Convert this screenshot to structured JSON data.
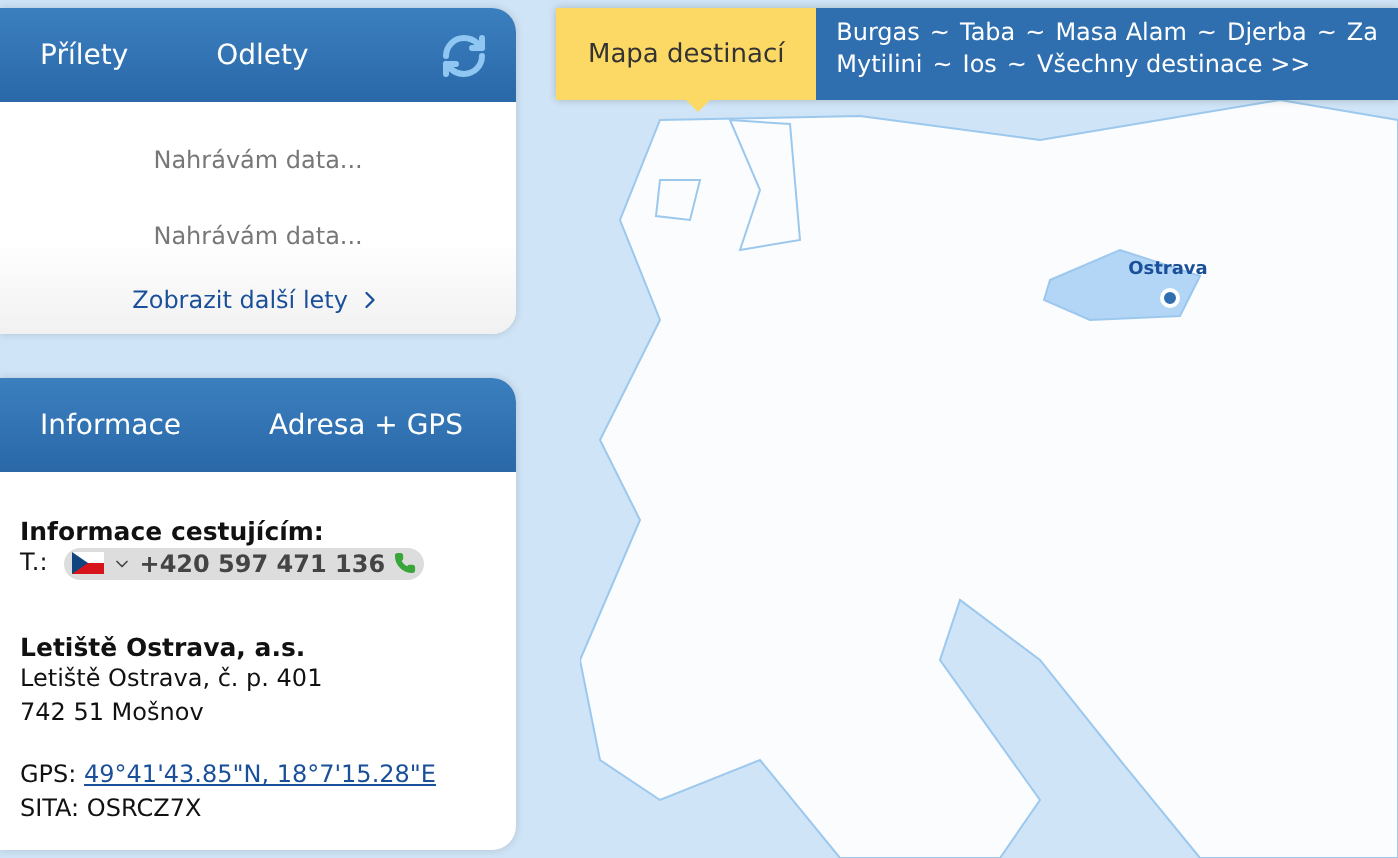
{
  "flights": {
    "tabs": [
      {
        "label": "Přílety"
      },
      {
        "label": "Odlety"
      }
    ],
    "rows": [
      "Nahrávám data...",
      "Nahrávám data..."
    ],
    "more_link": "Zobrazit další lety"
  },
  "info": {
    "tabs": [
      {
        "label": "Informace"
      },
      {
        "label": "Adresa + GPS"
      }
    ],
    "heading": "Informace cestujícím:",
    "phone_label": "T.:",
    "phone": "+420 597 471 136",
    "company": "Letiště Ostrava, a.s.",
    "address": [
      "Letiště Ostrava, č. p. 401",
      "742 51 Mošnov"
    ],
    "gps_label": "GPS:",
    "gps": "49°41'43.85\"N, 18°7'15.28\"E",
    "sita": "SITA: OSRCZ7X"
  },
  "destinations": {
    "tab": {
      "label": "Mapa destinací",
      "selected": true
    },
    "separator": "~",
    "lines": [
      [
        "Burgas",
        "Taba",
        "Masa Alam",
        "Djerba",
        "Za"
      ],
      [
        "Mytilini",
        "Ios",
        "Všechny destinace >>"
      ]
    ]
  },
  "map": {
    "marker": "Ostrava"
  }
}
